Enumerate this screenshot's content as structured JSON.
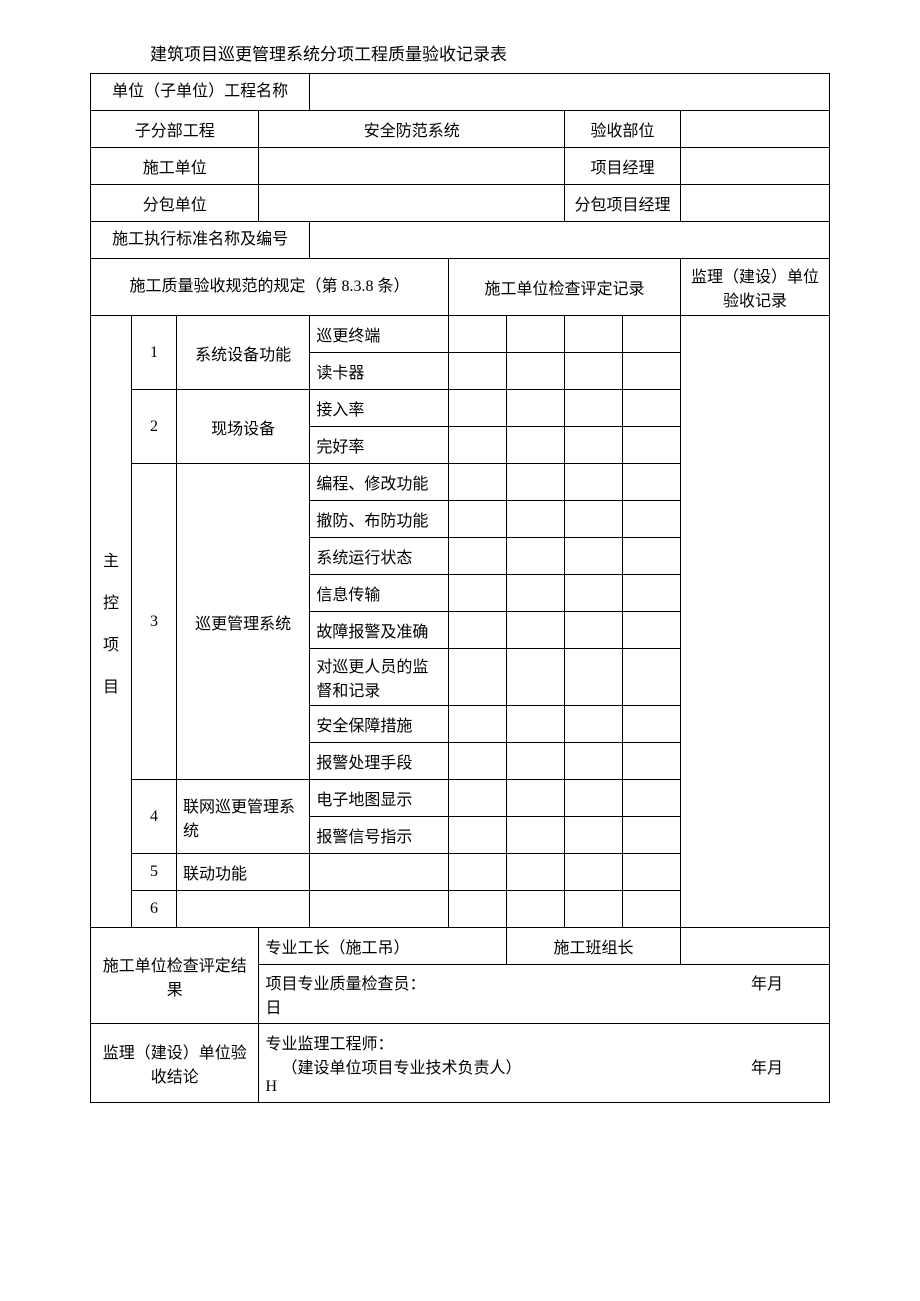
{
  "title": "建筑项目巡更管理系统分项工程质量验收记录表",
  "header": {
    "unit_name_label": "单位（子单位）工程名称",
    "sub_project_label": "子分部工程",
    "sub_project_value": "安全防范系统",
    "acceptance_part_label": "验收部位",
    "construction_unit_label": "施工单位",
    "project_manager_label": "项目经理",
    "subcontract_unit_label": "分包单位",
    "subcontract_manager_label": "分包项目经理",
    "standard_label": "施工执行标准名称及编号"
  },
  "columns": {
    "spec_label": "施工质量验收规范的规定（第 8.3.8 条）",
    "check_record_label": "施工单位检查评定记录",
    "supervise_record_label": "监理（建设）单位验收记录"
  },
  "main_control_label": "主控项目",
  "rows": {
    "r1_num": "1",
    "r1_cat": "系统设备功能",
    "r1_a": "巡更终端",
    "r1_b": "读卡器",
    "r2_num": "2",
    "r2_cat": "现场设备",
    "r2_a": "接入率",
    "r2_b": "完好率",
    "r3_num": "3",
    "r3_cat": "巡更管理系统",
    "r3_a": "编程、修改功能",
    "r3_b": "撤防、布防功能",
    "r3_c": "系统运行状态",
    "r3_d": "信息传输",
    "r3_e": "故障报警及准确",
    "r3_f": "对巡更人员的监督和记录",
    "r3_g": "安全保障措施",
    "r3_h": "报警处理手段",
    "r4_num": "4",
    "r4_cat": "联网巡更管理系统",
    "r4_a": "电子地图显示",
    "r4_b": "报警信号指示",
    "r5_num": "5",
    "r5_cat": "联动功能",
    "r6_num": "6"
  },
  "footer": {
    "construction_result_label": "施工单位检查评定结果",
    "foreman_label": "专业工长（施工吊）",
    "team_leader_label": "施工班组长",
    "quality_inspector_label": "项目专业质量检查员：",
    "date_label_1": "年月",
    "date_suffix_1": "日",
    "supervise_conclusion_label": "监理（建设）单位验收结论",
    "supervise_engineer_label": "专业监理工程师：",
    "supervise_engineer_sub": "（建设单位项目专业技术负责人）",
    "date_label_2": "年月",
    "trailing": "H"
  }
}
